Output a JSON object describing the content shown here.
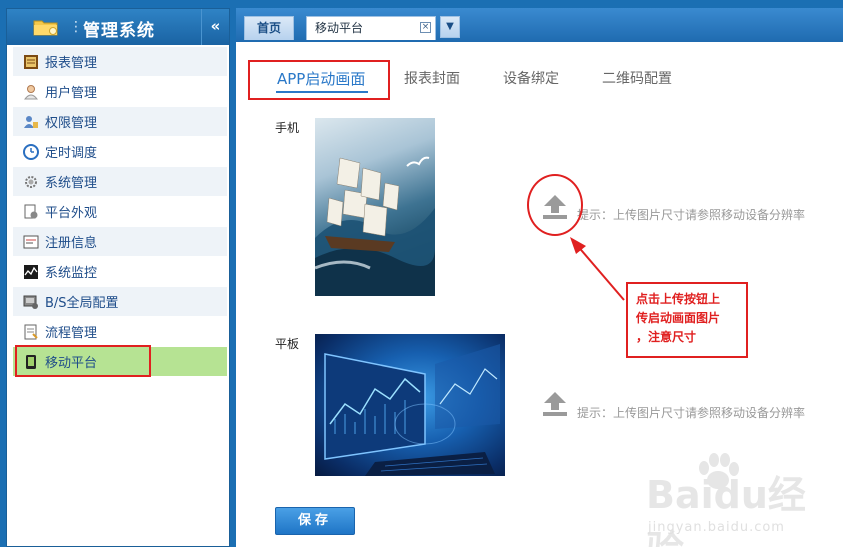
{
  "sidebar": {
    "title": "管理系统",
    "collapse": "«",
    "items": [
      {
        "label": "报表管理",
        "icon": "report-icon"
      },
      {
        "label": "用户管理",
        "icon": "user-icon"
      },
      {
        "label": "权限管理",
        "icon": "permission-icon"
      },
      {
        "label": "定时调度",
        "icon": "clock-icon"
      },
      {
        "label": "系统管理",
        "icon": "gear-icon"
      },
      {
        "label": "平台外观",
        "icon": "appearance-icon"
      },
      {
        "label": "注册信息",
        "icon": "register-icon"
      },
      {
        "label": "系统监控",
        "icon": "monitor-icon"
      },
      {
        "label": "B/S全局配置",
        "icon": "config-icon"
      },
      {
        "label": "流程管理",
        "icon": "workflow-icon"
      },
      {
        "label": "移动平台",
        "icon": "mobile-icon",
        "active": true
      }
    ]
  },
  "tabs": {
    "home": "首页",
    "mobile": "移动平台",
    "close": "⊠",
    "dropdown": "▼"
  },
  "subtabs": {
    "app_splash": "APP启动画面",
    "report_cover": "报表封面",
    "device_binding": "设备绑定",
    "qr_config": "二维码配置"
  },
  "devices": {
    "phone_label": "手机",
    "tablet_label": "平板",
    "hint": "提示：上传图片尺寸请参照移动设备分辨率"
  },
  "annotation": {
    "line1": "点击上传按钮上",
    "line2": "传启动画面图片",
    "line3": "，注意尺寸"
  },
  "save_label": "保存",
  "watermark": {
    "main": "Baidu经验",
    "sub": "jingyan.baidu.com"
  },
  "colors": {
    "accent": "#2a78c8",
    "header": "#1b6fb3",
    "active_menu": "#b6e393",
    "annotation_red": "#e02020"
  }
}
